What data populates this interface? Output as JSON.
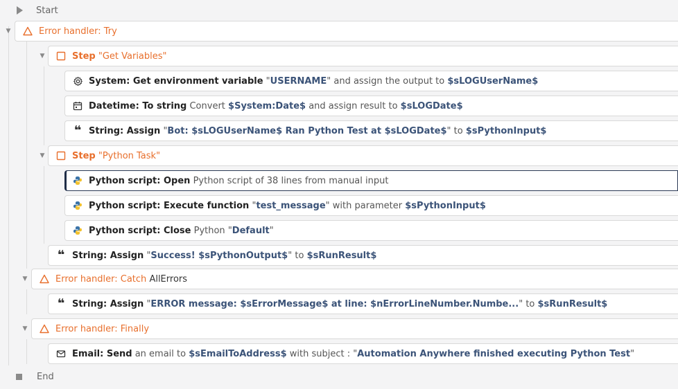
{
  "start_label": "Start",
  "end_label": "End",
  "try": {
    "prefix": "Error handler:",
    "word": "Try"
  },
  "step1": {
    "word": "Step",
    "name": "\"Get Variables\""
  },
  "a1": {
    "cmd": "System: Get environment variable",
    "q1": "\"",
    "val": "USERNAME",
    "q2": "\"",
    "mid": "and assign the output to",
    "var": "$sLOGUserName$"
  },
  "a2": {
    "cmd": "Datetime: To string",
    "mid1": "Convert",
    "var1": "$System:Date$",
    "mid2": "and assign result to",
    "var2": "$sLOGDate$"
  },
  "a3": {
    "cmd": "String: Assign",
    "q1": "\"",
    "val": "Bot: $sLOGUserName$ Ran Python Test at $sLOGDate$",
    "q2": "\"",
    "mid": "to",
    "var": "$sPythonInput$"
  },
  "step2": {
    "word": "Step",
    "name": "\"Python Task\""
  },
  "p1": {
    "cmd": "Python script: Open",
    "rest": "Python script of 38 lines from manual input"
  },
  "p2": {
    "cmd": "Python script: Execute function",
    "q1": "\"",
    "val": "test_message",
    "q2": "\"",
    "mid": "with parameter",
    "var": "$sPythonInput$"
  },
  "p3": {
    "cmd": "Python script: Close",
    "mid": "Python",
    "q1": "\"",
    "val": "Default",
    "q2": "\""
  },
  "s1": {
    "cmd": "String: Assign",
    "q1": "\"",
    "val": "Success! $sPythonOutput$",
    "q2": "\"",
    "mid": "to",
    "var": "$sRunResult$"
  },
  "catch": {
    "prefix": "Error handler: Catch",
    "word": "AllErrors"
  },
  "s2": {
    "cmd": "String: Assign",
    "q1": "\"",
    "val": "ERROR message: $sErrorMessage$ at line: $nErrorLineNumber.Numbe...",
    "q2": "\"",
    "mid": "to",
    "var": "$sRunResult$"
  },
  "fin": {
    "prefix": "Error handler: Finally"
  },
  "email": {
    "cmd": "Email: Send",
    "mid": "an email to",
    "var": "$sEmailToAddress$",
    "mid2": "with subject :",
    "q1": "\"",
    "val": "Automation Anywhere finished executing Python Test",
    "q2": "\""
  },
  "colors": {
    "accent": "#e86f2c",
    "variable": "#3b5378",
    "background": "#f4f4f5"
  }
}
